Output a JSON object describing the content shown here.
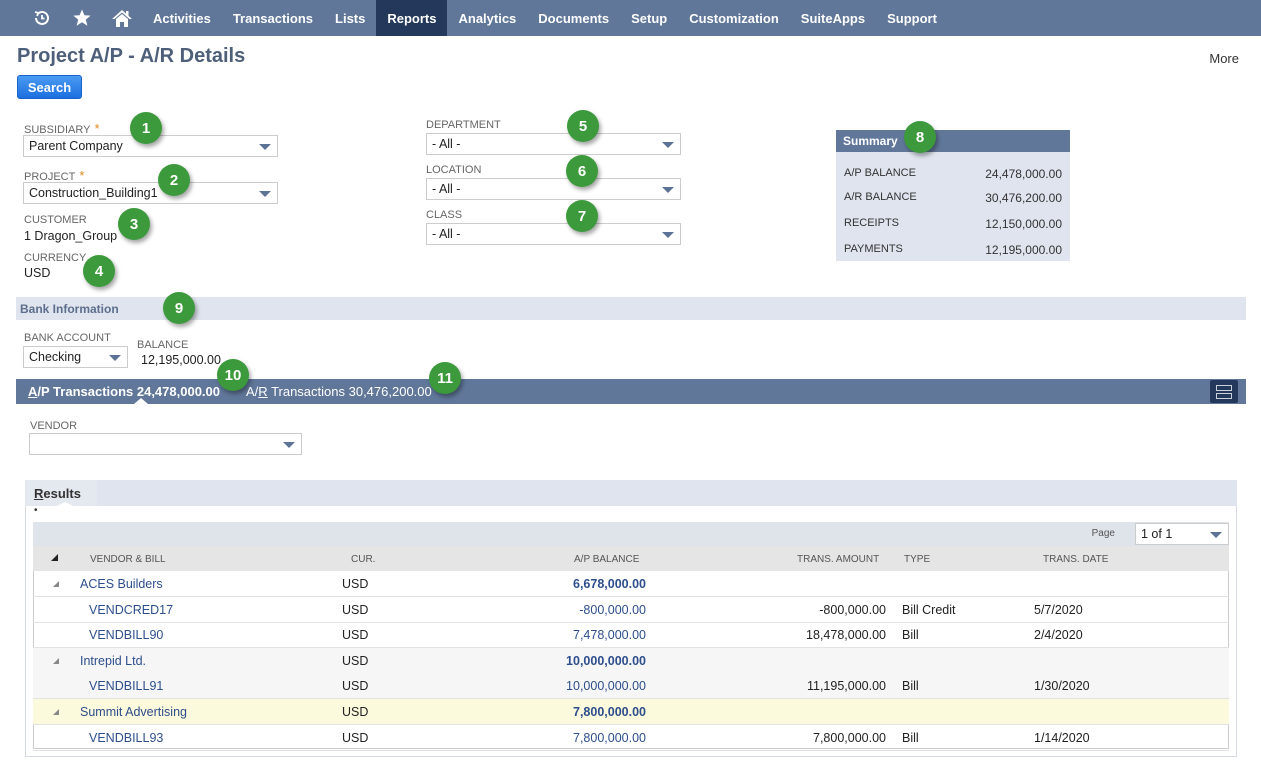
{
  "nav": {
    "icons": [
      "recent-icon",
      "favorites-star-icon",
      "home-icon"
    ],
    "items": [
      "Activities",
      "Transactions",
      "Lists",
      "Reports",
      "Analytics",
      "Documents",
      "Setup",
      "Customization",
      "SuiteApps",
      "Support"
    ],
    "active": "Reports"
  },
  "page": {
    "title": "Project A/P - A/R Details",
    "more_label": "More",
    "search_label": "Search"
  },
  "filters": {
    "subsidiary": {
      "label": "SUBSIDIARY",
      "required": "*",
      "value": "Parent Company"
    },
    "project": {
      "label": "PROJECT",
      "required": "*",
      "value": "Construction_Building1"
    },
    "customer": {
      "label": "CUSTOMER",
      "value": "1 Dragon_Group"
    },
    "currency": {
      "label": "CURRENCY",
      "value": "USD"
    },
    "department": {
      "label": "DEPARTMENT",
      "value": "- All -"
    },
    "location": {
      "label": "LOCATION",
      "value": "- All -"
    },
    "class": {
      "label": "CLASS",
      "value": "- All -"
    }
  },
  "summary": {
    "title": "Summary",
    "rows": [
      {
        "label": "A/P BALANCE",
        "value": "24,478,000.00"
      },
      {
        "label": "A/R BALANCE",
        "value": "30,476,200.00"
      },
      {
        "label": "RECEIPTS",
        "value": "12,150,000.00"
      },
      {
        "label": "PAYMENTS",
        "value": "12,195,000.00"
      }
    ]
  },
  "bank": {
    "title": "Bank Information",
    "account_label": "BANK ACCOUNT",
    "account_value": "Checking",
    "balance_label": "BALANCE",
    "balance_value": "12,195,000.00"
  },
  "tabs": {
    "ap": {
      "prefix": "A",
      "rest": "/P Transactions 24,478,000.00"
    },
    "ar": {
      "prefix": "A/",
      "underline": "R",
      "rest": " Transactions 30,476,200.00"
    }
  },
  "vendor": {
    "label": "VENDOR",
    "value": ""
  },
  "results": {
    "tab_underline": "R",
    "tab_rest": "esults",
    "tab_dot": "•",
    "page_label": "Page",
    "page_value": "1 of 1",
    "columns": [
      "VENDOR & BILL",
      "CUR.",
      "A/P BALANCE",
      "TRANS. AMOUNT",
      "TYPE",
      "TRANS. DATE"
    ],
    "rows": [
      {
        "group": true,
        "name": "ACES Builders",
        "cur": "USD",
        "balance": "6,678,000.00",
        "amount": "",
        "type": "",
        "date": ""
      },
      {
        "group": false,
        "name": "VENDCRED17",
        "cur": "USD",
        "balance": "-800,000.00",
        "amount": "-800,000.00",
        "type": "Bill Credit",
        "date": "5/7/2020"
      },
      {
        "group": false,
        "name": "VENDBILL90",
        "cur": "USD",
        "balance": "7,478,000.00",
        "amount": "18,478,000.00",
        "type": "Bill",
        "date": "2/4/2020"
      },
      {
        "group": true,
        "name": "Intrepid Ltd.",
        "cur": "USD",
        "balance": "10,000,000.00",
        "amount": "",
        "type": "",
        "date": ""
      },
      {
        "group": false,
        "name": "VENDBILL91",
        "cur": "USD",
        "balance": "10,000,000.00",
        "amount": "11,195,000.00",
        "type": "Bill",
        "date": "1/30/2020"
      },
      {
        "group": true,
        "name": "Summit Advertising",
        "cur": "USD",
        "balance": "7,800,000.00",
        "amount": "",
        "type": "",
        "date": "",
        "highlight": true
      },
      {
        "group": false,
        "name": "VENDBILL93",
        "cur": "USD",
        "balance": "7,800,000.00",
        "amount": "7,800,000.00",
        "type": "Bill",
        "date": "1/14/2020"
      }
    ]
  },
  "callouts": [
    "1",
    "2",
    "3",
    "4",
    "5",
    "6",
    "7",
    "8",
    "9",
    "10",
    "11"
  ],
  "colors": {
    "nav_bg": "#607799",
    "nav_active": "#24385b",
    "callout_green": "#3c9a3c",
    "link_blue": "#2d4e8c",
    "highlight_row": "#fcfadc"
  }
}
